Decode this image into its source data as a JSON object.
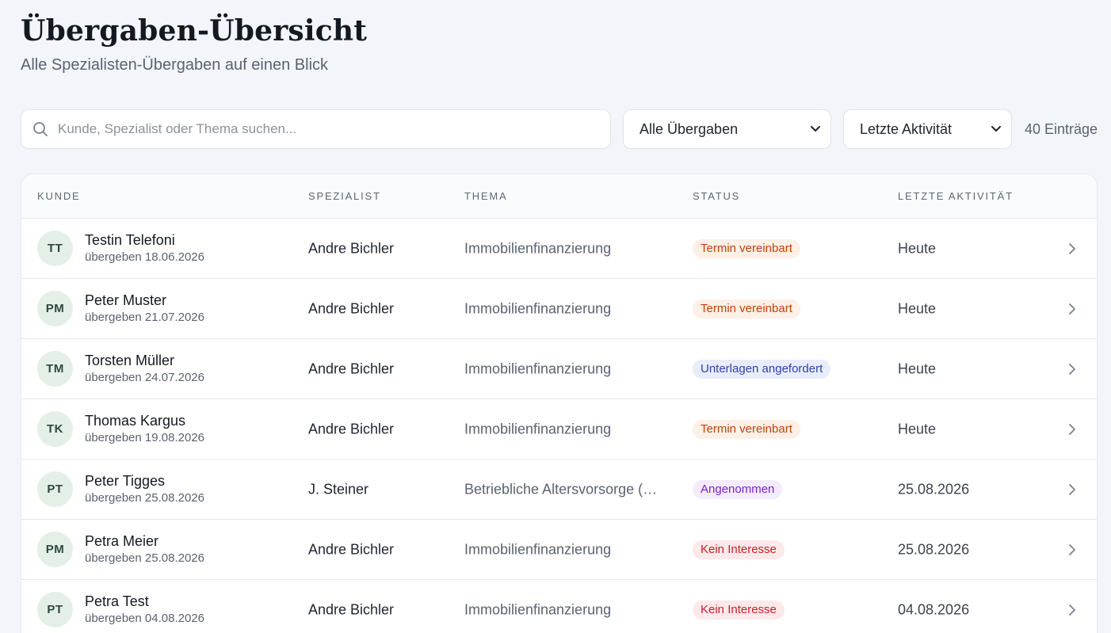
{
  "header": {
    "title": "Übergaben-Übersicht",
    "subtitle": "Alle Spezialisten-Übergaben auf einen Blick"
  },
  "toolbar": {
    "search_placeholder": "Kunde, Spezialist oder Thema suchen...",
    "search_value": "",
    "filter_selected": "Alle Übergaben",
    "sort_selected": "Letzte Aktivität",
    "entries_count": "40 Einträge"
  },
  "table": {
    "columns": [
      "Kunde",
      "Spezialist",
      "Thema",
      "Status",
      "Letzte Aktivität"
    ],
    "rows": [
      {
        "initials": "TT",
        "name": "Testin Telefoni",
        "handover": "übergeben 18.06.2026",
        "specialist": "Andre Bichler",
        "topic": "Immobilienfinanzierung",
        "status": "Termin vereinbart",
        "status_color": "orange",
        "activity": "Heute"
      },
      {
        "initials": "PM",
        "name": "Peter Muster",
        "handover": "übergeben 21.07.2026",
        "specialist": "Andre Bichler",
        "topic": "Immobilienfinanzierung",
        "status": "Termin vereinbart",
        "status_color": "orange",
        "activity": "Heute"
      },
      {
        "initials": "TM",
        "name": "Torsten Müller",
        "handover": "übergeben 24.07.2026",
        "specialist": "Andre Bichler",
        "topic": "Immobilienfinanzierung",
        "status": "Unterlagen angefordert",
        "status_color": "blue",
        "activity": "Heute"
      },
      {
        "initials": "TK",
        "name": "Thomas Kargus",
        "handover": "übergeben 19.08.2026",
        "specialist": "Andre Bichler",
        "topic": "Immobilienfinanzierung",
        "status": "Termin vereinbart",
        "status_color": "orange",
        "activity": "Heute"
      },
      {
        "initials": "PT",
        "name": "Peter Tigges",
        "handover": "übergeben 25.08.2026",
        "specialist": "J. Steiner",
        "topic": "Betriebliche Altersvorsorge (bAV)",
        "status": "Angenommen",
        "status_color": "purple",
        "activity": "25.08.2026"
      },
      {
        "initials": "PM",
        "name": "Petra Meier",
        "handover": "übergeben 25.08.2026",
        "specialist": "Andre Bichler",
        "topic": "Immobilienfinanzierung",
        "status": "Kein Interesse",
        "status_color": "red",
        "activity": "25.08.2026"
      },
      {
        "initials": "PT",
        "name": "Petra Test",
        "handover": "übergeben 04.08.2026",
        "specialist": "Andre Bichler",
        "topic": "Immobilienfinanzierung",
        "status": "Kein Interesse",
        "status_color": "red",
        "activity": "04.08.2026"
      }
    ]
  },
  "icons": {
    "search": "search-icon",
    "dropdown": "chevron-down-icon",
    "row_open": "chevron-right-icon"
  },
  "colors": {
    "background": "#f3f5fa",
    "avatar_bg": "#e4efe8",
    "status_orange": "#c2410c",
    "status_blue": "#3040b0",
    "status_purple": "#7e22ce",
    "status_red": "#c81e2a"
  }
}
